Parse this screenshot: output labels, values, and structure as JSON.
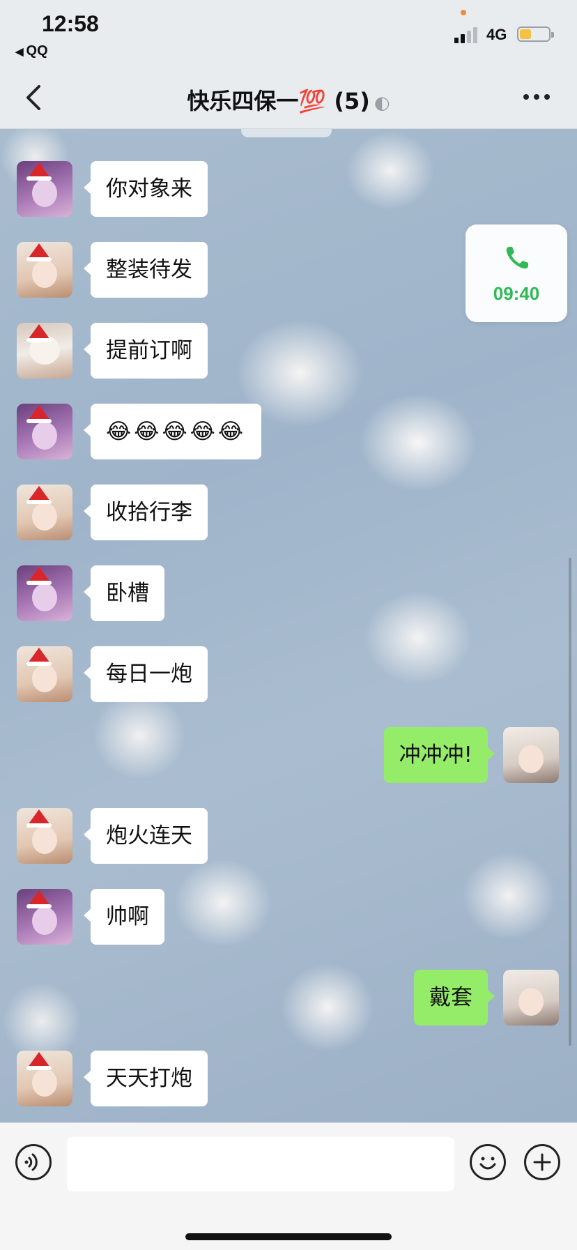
{
  "status_bar": {
    "time": "12:58",
    "back_app": "QQ",
    "network": "4G",
    "battery_level": 0.4
  },
  "nav": {
    "title": "快乐四保一💯 (5)",
    "ear_icon": "ear-icon",
    "more_icon": "ellipsis-icon"
  },
  "chat": {
    "partial_top_text": "",
    "messages": [
      {
        "side": "left",
        "sender_avatar": "avatar-purple-dragon",
        "text": "你对象来"
      },
      {
        "side": "left",
        "sender_avatar": "avatar-girl-smile",
        "text": "整装待发"
      },
      {
        "side": "left",
        "sender_avatar": "avatar-snow-white",
        "text": "提前订啊"
      },
      {
        "side": "left",
        "sender_avatar": "avatar-purple-dragon",
        "text": "😂😂😂😂😂"
      },
      {
        "side": "left",
        "sender_avatar": "avatar-girl-smile",
        "text": "收拾行李"
      },
      {
        "side": "left",
        "sender_avatar": "avatar-purple-dragon",
        "text": "卧槽"
      },
      {
        "side": "left",
        "sender_avatar": "avatar-girl-smile",
        "text": "每日一炮"
      },
      {
        "side": "right",
        "sender_avatar": "avatar-cat",
        "text": "冲冲冲!"
      },
      {
        "side": "left",
        "sender_avatar": "avatar-girl-smile",
        "text": "炮火连天"
      },
      {
        "side": "left",
        "sender_avatar": "avatar-purple-dragon",
        "text": "帅啊"
      },
      {
        "side": "right",
        "sender_avatar": "avatar-cat",
        "text": "戴套"
      },
      {
        "side": "left",
        "sender_avatar": "avatar-girl-smile",
        "text": "天天打炮"
      }
    ]
  },
  "call_widget": {
    "icon": "phone-icon",
    "duration": "09:40",
    "color": "#2fba55"
  },
  "input_bar": {
    "value": "",
    "placeholder": "",
    "voice_icon": "voice-icon",
    "emoji_icon": "emoji-icon",
    "plus_icon": "plus-icon"
  },
  "colors": {
    "bubble_left": "#ffffff",
    "bubble_right": "#95ec69",
    "accent_green": "#2fba55"
  }
}
